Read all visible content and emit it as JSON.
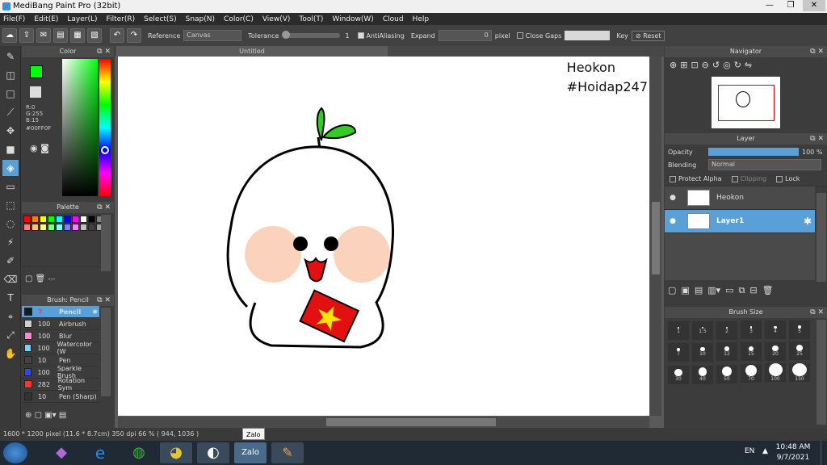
{
  "window": {
    "title": "MediBang Paint Pro (32bit)",
    "min": "—",
    "max": "❐",
    "close": "✕"
  },
  "menu": [
    "File(F)",
    "Edit(E)",
    "Layer(L)",
    "Filter(R)",
    "Select(S)",
    "Snap(N)",
    "Color(C)",
    "View(V)",
    "Tool(T)",
    "Window(W)",
    "Cloud",
    "Help"
  ],
  "toolbar": {
    "reference_label": "Reference",
    "reference_value": "Canvas",
    "tolerance_label": "Tolerance",
    "tolerance_value": "1",
    "antialiasing_label": "AntiAliasing",
    "expand_label": "Expand",
    "expand_value": "0",
    "expand_unit": "pixel",
    "close_gaps_label": "Close Gaps",
    "key_label": "Key",
    "reset_label": "Reset"
  },
  "color_panel": {
    "title": "Color",
    "r": "R:0",
    "g": "G:255",
    "b": "B:15",
    "hex": "#00FF0F",
    "fg": "#00ff0f",
    "bg": "#ffffff"
  },
  "palette_panel": {
    "title": "Palette",
    "footer": "---",
    "colors": [
      "#ff0000",
      "#ff8000",
      "#ffff00",
      "#00ff00",
      "#00ffff",
      "#0000ff",
      "#ff00ff",
      "#ffffff",
      "#000000",
      "#808080",
      "#ff8080",
      "#ffc080",
      "#ffff80",
      "#80ff80",
      "#80ffff",
      "#8080ff",
      "#ff80ff",
      "#c0c0c0",
      "#404040",
      "#a0a0a0"
    ]
  },
  "brush_panel": {
    "title": "Brush: Pencil",
    "items": [
      {
        "size": "7",
        "name": "Pencil",
        "color": "#1a1a1a",
        "active": true
      },
      {
        "size": "100",
        "name": "Airbrush",
        "color": "#cfcfcf"
      },
      {
        "size": "100",
        "name": "Blur",
        "color": "#ff88cc"
      },
      {
        "size": "100",
        "name": "Watercolor (W",
        "color": "#6fd4ff"
      },
      {
        "size": "10",
        "name": "Pen",
        "color": "#444444"
      },
      {
        "size": "100",
        "name": "Sparkle Brush",
        "color": "#3344ff"
      },
      {
        "size": "282",
        "name": "Rotation Sym",
        "color": "#ff3333"
      },
      {
        "size": "10",
        "name": "Pen (Sharp)",
        "color": "#333333"
      }
    ]
  },
  "canvas": {
    "tab_title": "Untitled",
    "text_line1": "Heokon",
    "text_line2": "#Hoidap247"
  },
  "navigator": {
    "title": "Navigator"
  },
  "layer_panel": {
    "title": "Layer",
    "opacity_label": "Opacity",
    "opacity_value": "100 %",
    "opacity_fraction": 1.0,
    "blending_label": "Blending",
    "blending_value": "Normal",
    "protect_alpha": "Protect Alpha",
    "clipping": "Clipping",
    "lock": "Lock",
    "layers": [
      {
        "name": "Heokon",
        "active": false
      },
      {
        "name": "Layer1",
        "active": true
      }
    ]
  },
  "brush_size_panel": {
    "title": "Brush Size",
    "sizes": [
      "1",
      "1.5",
      "2",
      "3",
      "4",
      "5",
      "7",
      "10",
      "12",
      "15",
      "20",
      "25",
      "30",
      "40",
      "50",
      "70",
      "100",
      "150"
    ]
  },
  "status": {
    "text": "1600 * 1200 pixel   (11.6 * 8.7cm)   350 dpi   66 %   ( 944, 1036 )"
  },
  "taskbar": {
    "tooltip": "Zalo",
    "lang": "EN",
    "time": "10:48 AM",
    "date": "9/7/2021"
  }
}
